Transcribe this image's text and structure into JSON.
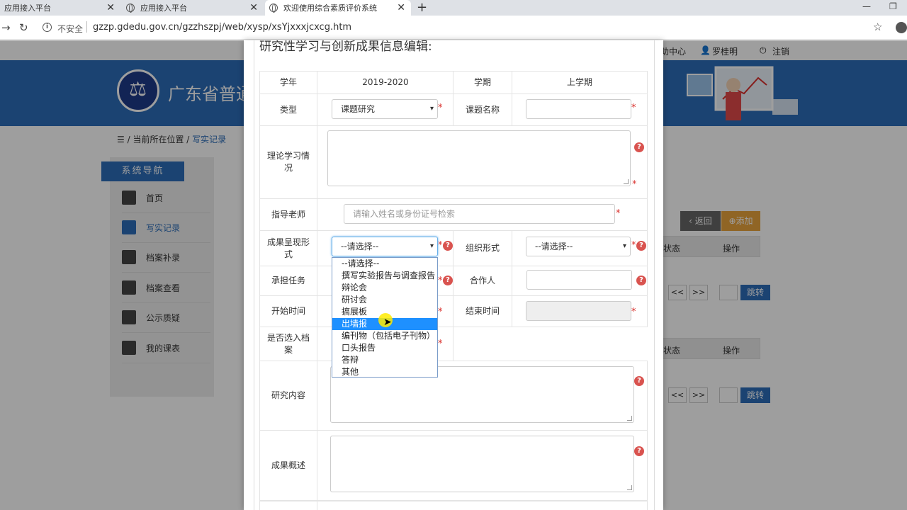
{
  "browser": {
    "tabs": [
      {
        "title": "应用接入平台"
      },
      {
        "title": "应用接入平台"
      },
      {
        "title": "欢迎使用综合素质评价系统"
      }
    ],
    "security_label": "不安全",
    "url": "gzzp.gdedu.gov.cn/gzzhszpj/web/xysp/xsYjxxxjcxcg.htm"
  },
  "site": {
    "top_links": [
      "助中心",
      "罗桂明",
      "注销"
    ],
    "banner_title": "广东省普通",
    "breadcrumb": {
      "label": "当前所在位置",
      "link": "写实记录"
    },
    "sidebar": {
      "title": "系统导航",
      "items": [
        {
          "label": "首页"
        },
        {
          "label": "写实记录"
        },
        {
          "label": "档案补录"
        },
        {
          "label": "档案查看"
        },
        {
          "label": "公示质疑"
        },
        {
          "label": "我的课表"
        }
      ]
    },
    "buttons": {
      "back": "返回",
      "add": "添加"
    },
    "table_headers": [
      "状态",
      "操作"
    ],
    "pager": {
      "first": "<<",
      "last": ">>",
      "go": "跳转"
    }
  },
  "modal": {
    "title": "研究性学习与创新成果信息编辑:",
    "fields": {
      "year_label": "学年",
      "year_value": "2019-2020",
      "term_label": "学期",
      "term_value": "上学期",
      "type_label": "类型",
      "type_value": "课题研究",
      "topic_label": "课题名称",
      "theory_label": "理论学习情况",
      "teacher_label": "指导老师",
      "teacher_placeholder": "请输入姓名或身份证号检索",
      "result_form_label": "成果呈现形式",
      "result_form_value": "--请选择--",
      "org_form_label": "组织形式",
      "org_form_value": "--请选择--",
      "task_label": "承担任务",
      "partner_label": "合作人",
      "start_label": "开始时间",
      "end_label": "结束时间",
      "archive_label": "是否选入档案",
      "content_label": "研究内容",
      "summary_label": "成果概述"
    },
    "dropdown_options": [
      "--请选择--",
      "撰写实验报告与调查报告",
      "辩论会",
      "研讨会",
      "搞展板",
      "出墙报",
      "编刊物（包括电子刊物）",
      "口头报告",
      "答辩",
      "其他"
    ],
    "dropdown_highlighted": "出墙报"
  },
  "colors": {
    "accent": "#2d6db8",
    "required": "#d9302c",
    "highlight": "#1e90ff"
  }
}
